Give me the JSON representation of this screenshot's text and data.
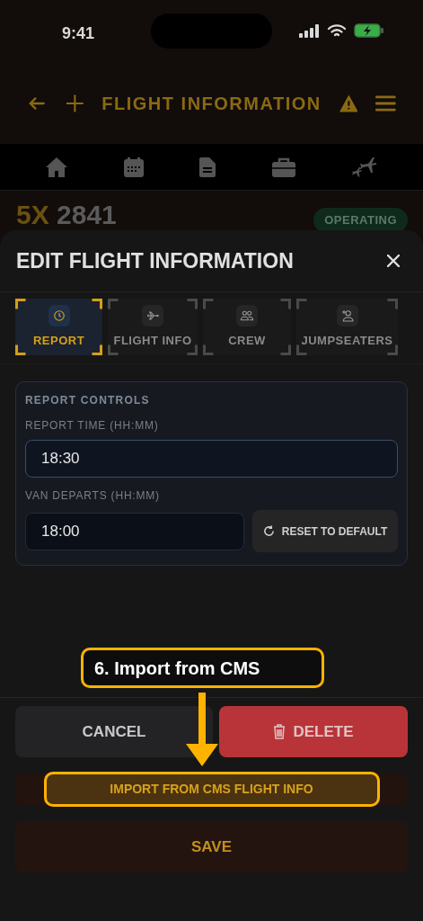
{
  "status_bar": {
    "time": "9:41"
  },
  "header": {
    "title": "FLIGHT INFORMATION"
  },
  "flight": {
    "carrier": "5X",
    "number": "2841",
    "status": "OPERATING"
  },
  "sheet": {
    "title": "EDIT FLIGHT INFORMATION",
    "tabs": [
      {
        "label": "REPORT",
        "kind": "clock",
        "selected": true
      },
      {
        "label": "FLIGHT INFO",
        "kind": "plane",
        "selected": false
      },
      {
        "label": "CREW",
        "kind": "people",
        "selected": false
      },
      {
        "label": "JUMPSEATERS",
        "kind": "person-add",
        "selected": false
      }
    ],
    "section": {
      "title": "REPORT CONTROLS",
      "report_time": {
        "label": "REPORT TIME (HH:MM)",
        "value": "18:30"
      },
      "van_departs": {
        "label": "VAN DEPARTS (HH:MM)",
        "value": "18:00"
      },
      "reset_button": "RESET TO DEFAULT"
    },
    "buttons": {
      "cancel": "CANCEL",
      "delete": "DELETE",
      "import": "IMPORT FROM CMS FLIGHT INFO",
      "save": "SAVE"
    }
  },
  "annotation": {
    "text": "6. Import from CMS"
  }
}
